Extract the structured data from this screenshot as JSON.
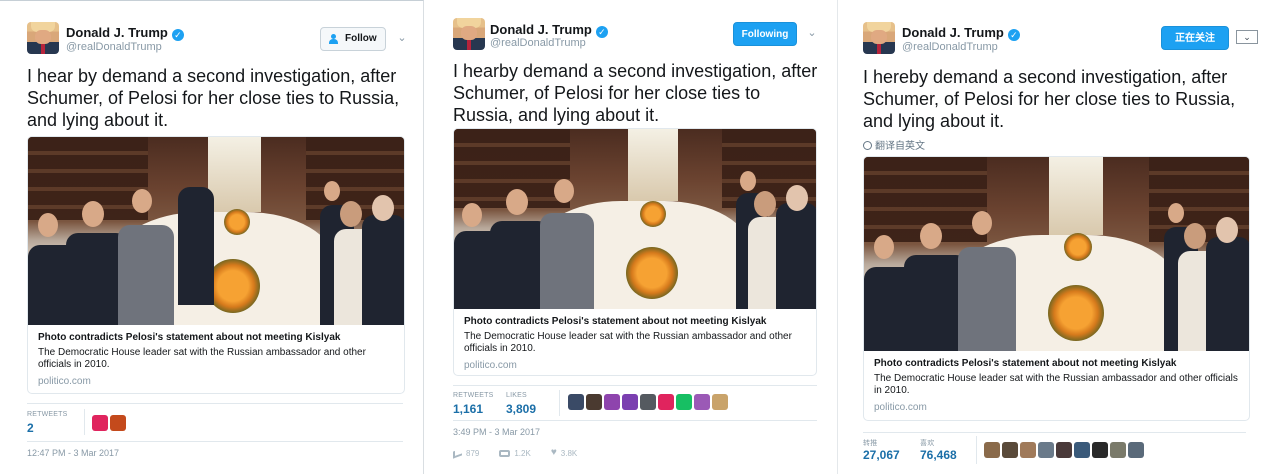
{
  "panels": [
    {
      "name": "Donald J. Trump",
      "handle": "@realDonaldTrump",
      "follow_button": "Follow",
      "text": "I hear by demand a second investigation, after Schumer, of Pelosi for her close ties to Russia, and lying about it.",
      "card": {
        "title": "Photo contradicts Pelosi's statement about not meeting Kislyak",
        "description": "The Democratic House leader sat with the Russian ambassador and other officials in 2010.",
        "domain": "politico.com"
      },
      "retweets_label": "RETWEETS",
      "retweets": "2",
      "timestamp": "12:47 PM - 3 Mar 2017"
    },
    {
      "name": "Donald J. Trump",
      "handle": "@realDonaldTrump",
      "follow_button": "Following",
      "text": "I hearby demand a second investigation, after Schumer, of Pelosi for her close ties to Russia, and lying about it.",
      "card": {
        "title": "Photo contradicts Pelosi's statement about not meeting Kislyak",
        "description": "The Democratic House leader sat with the Russian ambassador and other officials in 2010.",
        "domain": "politico.com"
      },
      "retweets_label": "RETWEETS",
      "retweets": "1,161",
      "likes_label": "LIKES",
      "likes": "3,809",
      "timestamp": "3:49 PM - 3 Mar 2017",
      "actions": {
        "replies": "879",
        "retweets": "1.2K",
        "likes": "3.8K"
      }
    },
    {
      "name": "Donald J. Trump",
      "handle": "@realDonaldTrump",
      "follow_button": "正在关注",
      "text": "I hereby demand a second investigation, after Schumer, of Pelosi for her close ties to Russia, and lying about it.",
      "translate": "翻译自英文",
      "card": {
        "title": "Photo contradicts Pelosi's statement about not meeting Kislyak",
        "description": "The Democratic House leader sat with the Russian ambassador and other officials in 2010.",
        "domain": "politico.com"
      },
      "retweets_label": "转推",
      "retweets": "27,067",
      "likes_label": "喜欢",
      "likes": "76,468"
    }
  ],
  "colors": {
    "accent": "#1da1f2",
    "stat_value": "#1b6fa8",
    "muted": "#8899a6"
  }
}
